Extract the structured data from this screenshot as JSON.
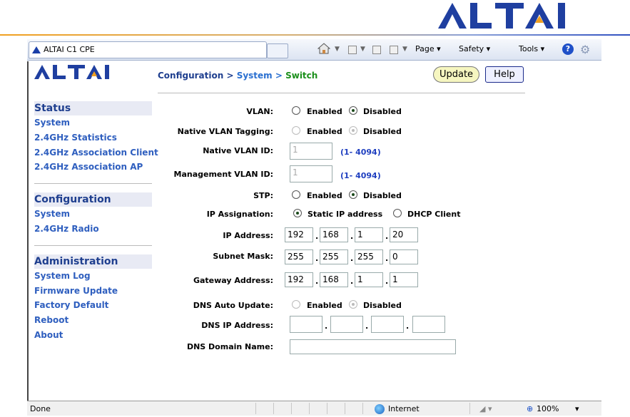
{
  "brand": {
    "logo_text": "ALTAI"
  },
  "browser": {
    "tab_title": "ALTAI C1 CPE",
    "commands": {
      "page": "Page ▾",
      "safety": "Safety ▾",
      "tools": "Tools ▾",
      "help": "?"
    },
    "status": {
      "left": "Done",
      "zone": "Internet",
      "zoom": "100%"
    }
  },
  "header": {
    "logo_text": "ALTAI",
    "breadcrumb": {
      "a": "Configuration > ",
      "b": "System > ",
      "c": "Switch"
    },
    "update_label": "Update",
    "help_label": "Help"
  },
  "sidebar": {
    "status": {
      "title": "Status",
      "items": [
        "System",
        "2.4GHz Statistics",
        "2.4GHz Association Client",
        "2.4GHz Association AP"
      ]
    },
    "configuration": {
      "title": "Configuration",
      "items": [
        "System",
        "2.4GHz Radio"
      ]
    },
    "administration": {
      "title": "Administration",
      "items": [
        "System Log",
        "Firmware Update",
        "Factory Default",
        "Reboot",
        "About"
      ]
    }
  },
  "form": {
    "vlan": {
      "label": "VLAN:",
      "opt1": "Enabled",
      "opt2": "Disabled",
      "selected": "Disabled"
    },
    "native_tagging": {
      "label": "Native VLAN Tagging:",
      "opt1": "Enabled",
      "opt2": "Disabled",
      "selected": "Disabled"
    },
    "native_vlan_id": {
      "label": "Native VLAN ID:",
      "value": "1",
      "range": "(1- 4094)"
    },
    "mgmt_vlan_id": {
      "label": "Management VLAN ID:",
      "value": "1",
      "range": "(1- 4094)"
    },
    "stp": {
      "label": "STP:",
      "opt1": "Enabled",
      "opt2": "Disabled",
      "selected": "Disabled"
    },
    "ip_assign": {
      "label": "IP Assignation:",
      "opt1": "Static IP address",
      "opt2": "DHCP Client",
      "selected": "Static IP address"
    },
    "ip_address": {
      "label": "IP Address:",
      "octets": [
        "192",
        "168",
        "1",
        "20"
      ]
    },
    "subnet_mask": {
      "label": "Subnet Mask:",
      "octets": [
        "255",
        "255",
        "255",
        "0"
      ]
    },
    "gateway": {
      "label": "Gateway Address:",
      "octets": [
        "192",
        "168",
        "1",
        "1"
      ]
    },
    "dns_auto": {
      "label": "DNS Auto Update:",
      "opt1": "Enabled",
      "opt2": "Disabled",
      "selected": "Disabled"
    },
    "dns_ip": {
      "label": "DNS IP Address:",
      "octets": [
        "",
        "",
        "",
        ""
      ]
    },
    "dns_domain": {
      "label": "DNS Domain Name:",
      "value": ""
    }
  },
  "colors": {
    "brand_blue": "#1f3f8f",
    "link_blue": "#2f5fbf",
    "accent_orange": "#f0a020"
  }
}
